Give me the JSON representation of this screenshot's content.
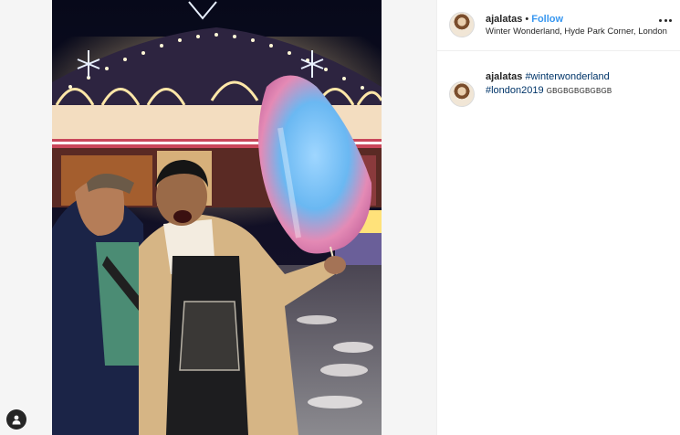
{
  "post": {
    "username": "ajalatas",
    "separator": "•",
    "follow_label": "Follow",
    "location": "Winter Wonderland, Hyde Park Corner, London",
    "more_icon": "more-horizontal-icon",
    "caption": {
      "username": "ajalatas",
      "hashtag1": "#winterwonderland",
      "hashtag2": "#london2019",
      "extra": "GBGBGBGBGBGB"
    },
    "user_tag_icon": "user-silhouette-icon"
  },
  "colors": {
    "follow": "#3897f0",
    "hashtag": "#003569",
    "text": "#262626",
    "divider": "#efefef",
    "background": "#fafafa"
  }
}
